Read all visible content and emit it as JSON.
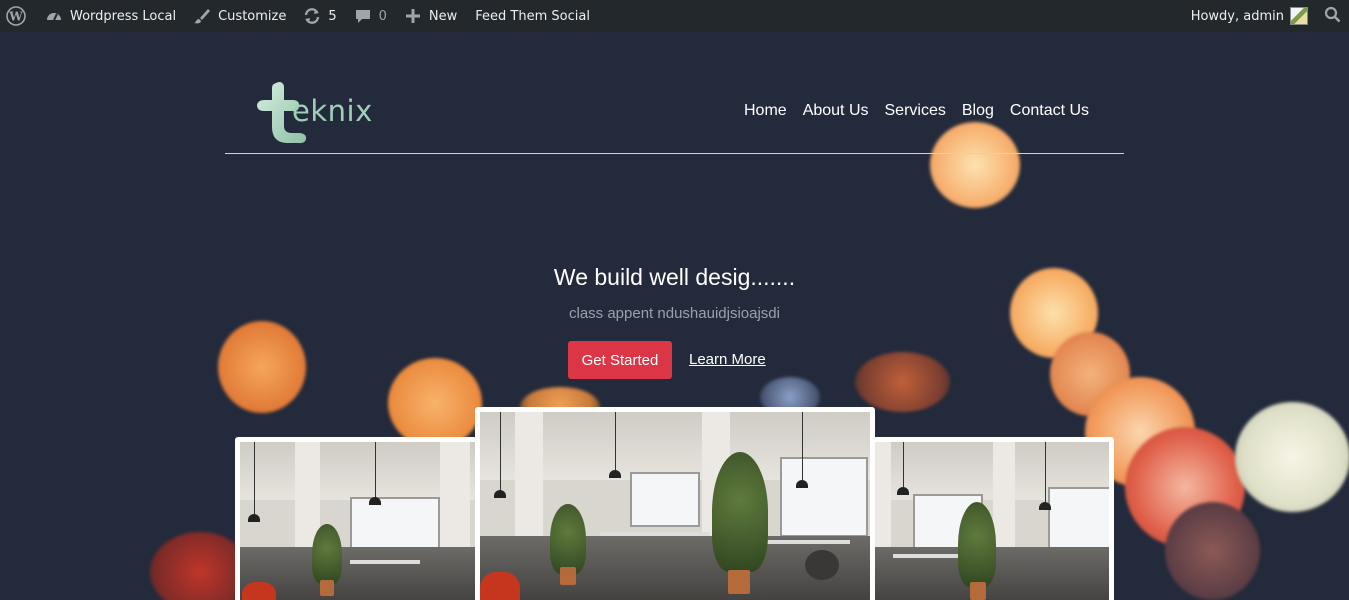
{
  "adminbar": {
    "wp_icon": "wordpress-logo-icon",
    "site_name": "Wordpress Local",
    "customize": "Customize",
    "updates_count": "5",
    "comments_count": "0",
    "new_label": "New",
    "plugin_label": "Feed Them Social",
    "howdy": "Howdy, admin",
    "search_icon": "search-icon"
  },
  "header": {
    "logo_text": "eknix",
    "nav": [
      "Home",
      "About Us",
      "Services",
      "Blog",
      "Contact Us"
    ]
  },
  "hero": {
    "headline": "We build well desig.......",
    "subtitle": "class appent ndushauidjsioajsdi",
    "primary_button": "Get Started",
    "secondary_link": "Learn More"
  },
  "colors": {
    "adminbar_bg": "#23282d",
    "page_bg": "#232a3b",
    "accent_red": "#dc3545",
    "logo_green": "#9fd0b7"
  }
}
